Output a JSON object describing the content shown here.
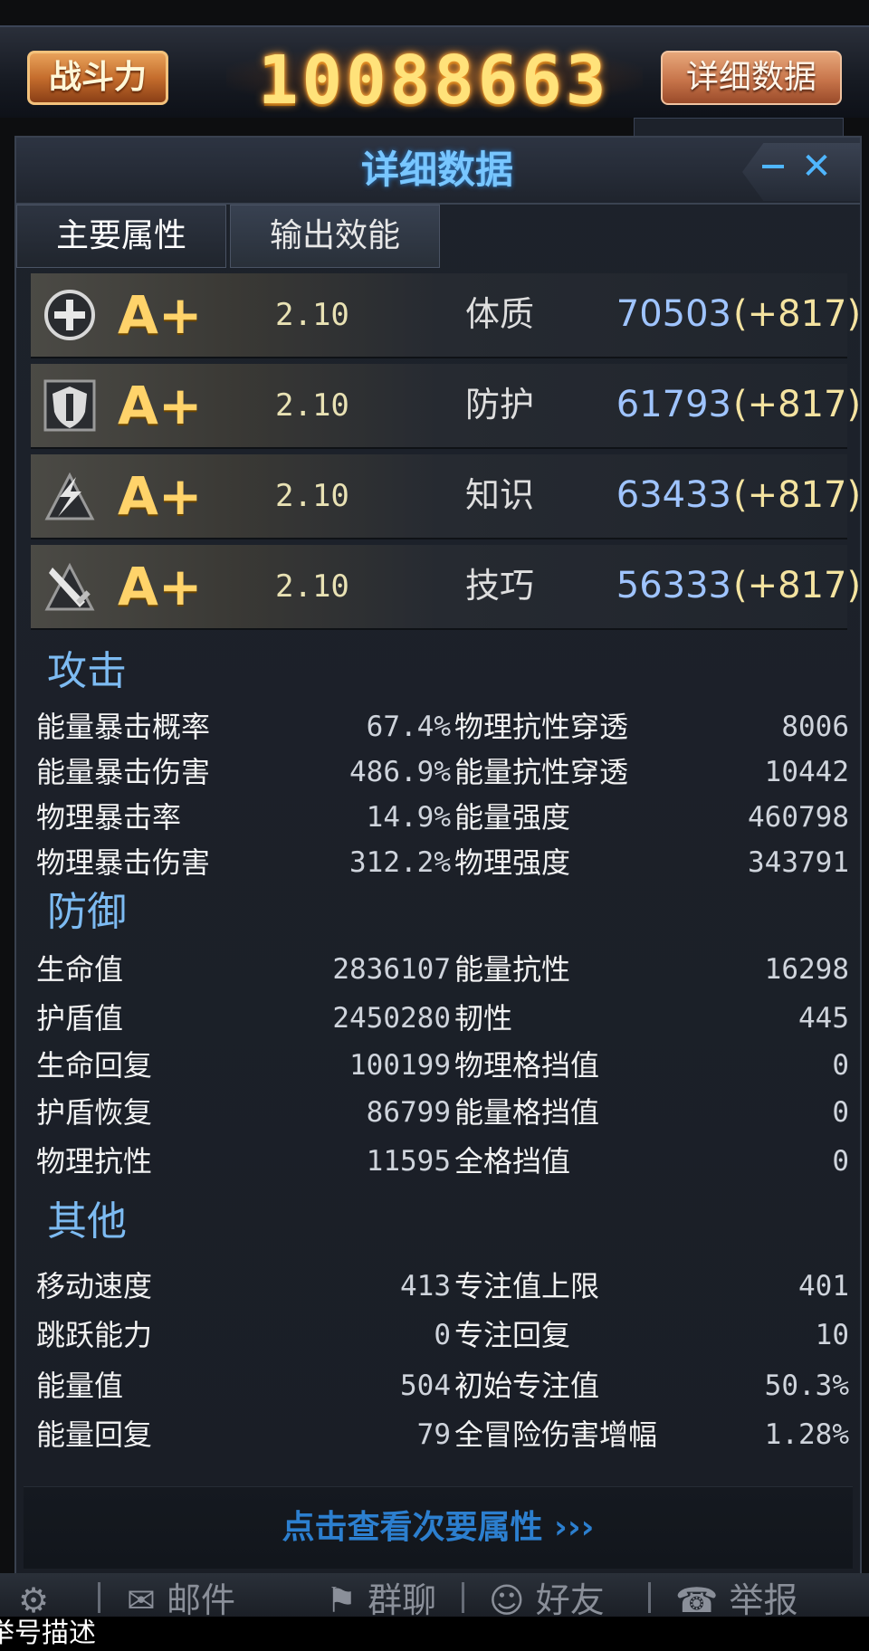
{
  "top": {
    "power_label": "战斗力",
    "power_value": "10088663",
    "detail_button": "详细数据"
  },
  "panel": {
    "title": "详细数据",
    "close": "✕",
    "tabs": [
      "主要属性",
      "输出效能"
    ]
  },
  "attributes": [
    {
      "icon": "plus-icon",
      "grade": "A+",
      "mult": "2.10",
      "name": "体质",
      "value": "70503",
      "bonus": "(+817)"
    },
    {
      "icon": "shield-icon",
      "grade": "A+",
      "mult": "2.10",
      "name": "防护",
      "value": "61793",
      "bonus": "(+817)"
    },
    {
      "icon": "lightning-icon",
      "grade": "A+",
      "mult": "2.10",
      "name": "知识",
      "value": "63433",
      "bonus": "(+817)"
    },
    {
      "icon": "sword-icon",
      "grade": "A+",
      "mult": "2.10",
      "name": "技巧",
      "value": "56333",
      "bonus": "(+817)"
    }
  ],
  "sections": {
    "attack": {
      "title": "攻击",
      "left": [
        {
          "label": "能量暴击概率",
          "value": "67.4%"
        },
        {
          "label": "能量暴击伤害",
          "value": "486.9%"
        },
        {
          "label": "物理暴击率",
          "value": "14.9%"
        },
        {
          "label": "物理暴击伤害",
          "value": "312.2%"
        }
      ],
      "right": [
        {
          "label": "物理抗性穿透",
          "value": "8006"
        },
        {
          "label": "能量抗性穿透",
          "value": "10442"
        },
        {
          "label": "能量强度",
          "value": "460798"
        },
        {
          "label": "物理强度",
          "value": "343791"
        }
      ]
    },
    "defense": {
      "title": "防御",
      "left": [
        {
          "label": "生命值",
          "value": "2836107"
        },
        {
          "label": "护盾值",
          "value": "2450280"
        },
        {
          "label": "生命回复",
          "value": "100199"
        },
        {
          "label": "护盾恢复",
          "value": "86799"
        },
        {
          "label": "物理抗性",
          "value": "11595"
        }
      ],
      "right": [
        {
          "label": "能量抗性",
          "value": "16298"
        },
        {
          "label": "韧性",
          "value": "445"
        },
        {
          "label": "物理格挡值",
          "value": "0"
        },
        {
          "label": "能量格挡值",
          "value": "0"
        },
        {
          "label": "全格挡值",
          "value": "0"
        }
      ]
    },
    "other": {
      "title": "其他",
      "left": [
        {
          "label": "移动速度",
          "value": "413"
        },
        {
          "label": "跳跃能力",
          "value": "0"
        },
        {
          "label": "能量值",
          "value": "504"
        },
        {
          "label": "能量回复",
          "value": "79"
        }
      ],
      "right": [
        {
          "label": "专注值上限",
          "value": "401"
        },
        {
          "label": "专注回复",
          "value": "10"
        },
        {
          "label": "初始专注值",
          "value": "50.3%"
        },
        {
          "label": "全冒险伤害增幅",
          "value": "1.28%"
        }
      ]
    }
  },
  "footer_link": "点击查看次要属性 ›››",
  "bottom_nav": {
    "settings": "⚙",
    "mail": "邮件",
    "group_chat": "群聊",
    "friends": "好友",
    "report": "举报"
  },
  "caption": "举号描述"
}
